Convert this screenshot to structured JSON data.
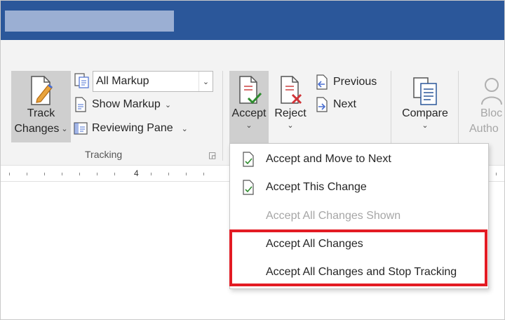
{
  "ribbon": {
    "tracking": {
      "group_label": "Tracking",
      "track_changes_line1": "Track",
      "track_changes_line2": "Changes",
      "markup_combo_value": "All Markup",
      "show_markup": "Show Markup",
      "reviewing_pane": "Reviewing Pane"
    },
    "changes": {
      "accept": "Accept",
      "reject": "Reject",
      "previous": "Previous",
      "next": "Next"
    },
    "compare": {
      "compare": "Compare"
    },
    "protect": {
      "block_line1": "Bloc",
      "block_line2": "Autho"
    }
  },
  "ruler": {
    "number": "4"
  },
  "accept_menu": {
    "items": [
      {
        "label": "Accept and Move to Next",
        "enabled": true
      },
      {
        "label": "Accept This Change",
        "enabled": true
      },
      {
        "label": "Accept All Changes Shown",
        "enabled": false
      },
      {
        "label": "Accept All Changes",
        "enabled": true
      },
      {
        "label": "Accept All Changes and Stop Tracking",
        "enabled": true
      }
    ]
  },
  "colors": {
    "titlebar": "#2b579a",
    "ribbon": "#f3f3f3",
    "highlight_border": "#e31b23",
    "accept_check": "#2e8b2e",
    "reject_x": "#d13438"
  },
  "icons": {
    "track_changes": "document-pencil-icon",
    "accept": "document-check-icon",
    "reject": "document-x-icon",
    "previous": "document-prev-icon",
    "next": "document-next-icon",
    "compare": "compare-documents-icon",
    "block_authors": "person-icon"
  }
}
